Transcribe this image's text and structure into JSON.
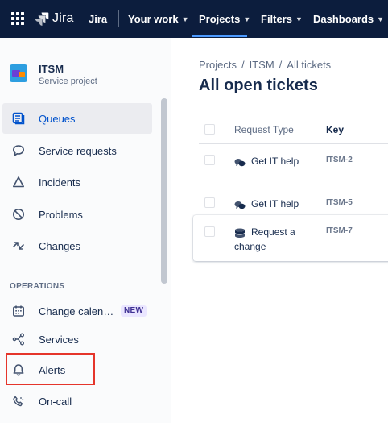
{
  "topnav": {
    "product": "Jira",
    "items": [
      {
        "label": "Jira"
      },
      {
        "label": "Your work"
      },
      {
        "label": "Projects"
      },
      {
        "label": "Filters"
      },
      {
        "label": "Dashboards"
      }
    ],
    "active_item": "Projects"
  },
  "sidebar": {
    "project_name": "ITSM",
    "project_type": "Service project",
    "items": [
      {
        "label": "Queues",
        "icon": "queues-icon",
        "selected": true
      },
      {
        "label": "Service requests",
        "icon": "chat-icon"
      },
      {
        "label": "Incidents",
        "icon": "warning-triangle-icon"
      },
      {
        "label": "Problems",
        "icon": "problem-icon"
      },
      {
        "label": "Changes",
        "icon": "changes-icon"
      }
    ],
    "section_title": "OPERATIONS",
    "operations": [
      {
        "label": "Change calen…",
        "icon": "calendar-icon",
        "badge": "NEW"
      },
      {
        "label": "Services",
        "icon": "services-icon"
      },
      {
        "label": "Alerts",
        "icon": "bell-icon",
        "highlighted": true
      },
      {
        "label": "On-call",
        "icon": "on-call-icon"
      }
    ]
  },
  "main": {
    "breadcrumbs": [
      "Projects",
      "ITSM",
      "All tickets"
    ],
    "title": "All open tickets",
    "table": {
      "columns": [
        "Request Type",
        "Key"
      ],
      "rows": [
        {
          "request_type": "Get IT help",
          "icon": "chat-bubbles-icon",
          "key": "ITSM-2"
        },
        {
          "request_type": "Get IT help",
          "icon": "chat-bubbles-icon",
          "key": "ITSM-5"
        },
        {
          "request_type_line1": "Request a",
          "request_type_line2": "change",
          "icon": "database-icon",
          "key": "ITSM-7"
        }
      ]
    }
  },
  "colors": {
    "topnav_bg": "#0c1d3d",
    "active_underline": "#4c9aff",
    "selected_text": "#0052cc",
    "highlight_box": "#e5352b",
    "badge_bg": "#eae6ff",
    "badge_text": "#403294"
  }
}
